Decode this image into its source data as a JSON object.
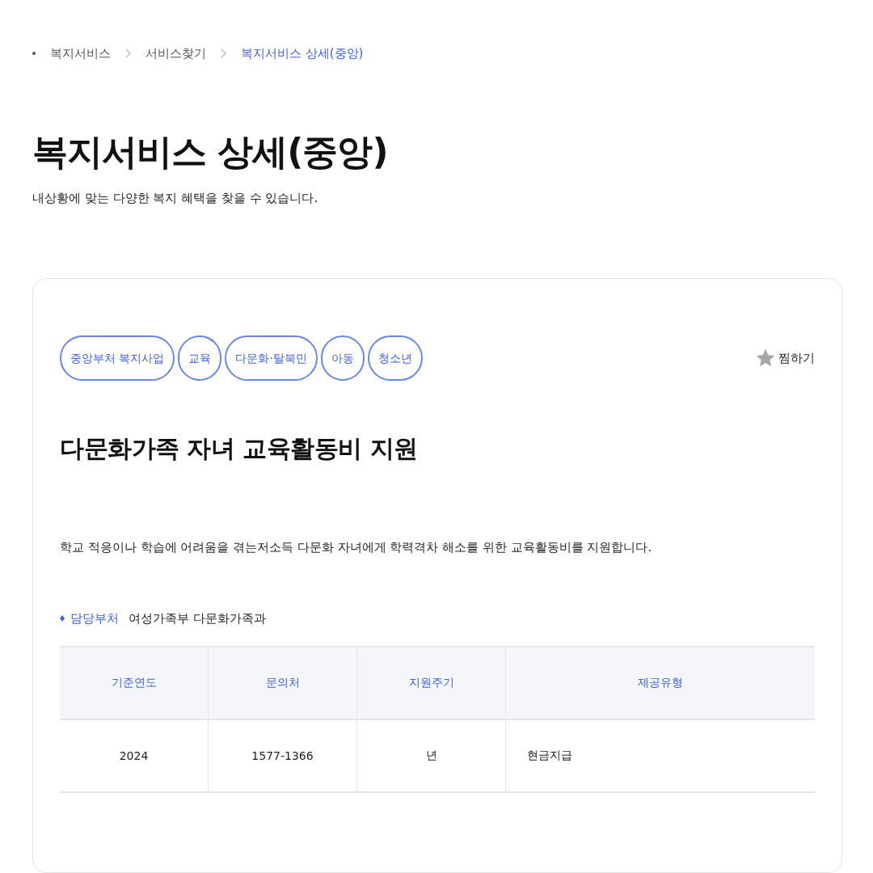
{
  "breadcrumb": [
    {
      "label": "복지서비스",
      "current": false
    },
    {
      "label": "서비스찾기",
      "current": false
    },
    {
      "label": "복지서비스 상세(중앙)",
      "current": true
    }
  ],
  "page": {
    "title": "복지서비스 상세(중앙)",
    "subtitle": "내상황에 맞는 다양한 복지 혜택을 찾을 수 있습니다."
  },
  "service": {
    "tags": [
      "중앙부처 복지사업",
      "교육",
      "다문화·탈북민",
      "아동",
      "청소년"
    ],
    "favorite": {
      "label": "찜하기",
      "on": false
    },
    "title": "다문화가족 자녀 교육활동비 지원",
    "description": "학교 적응이나 학습에 어려움을 겪는저소득 다문화 자녀에게 학력격차 해소를 위한 교육활동비를 지원합니다.",
    "department": {
      "label": "담당부처",
      "value": "여성가족부 다문화가족과"
    },
    "table": {
      "columns": [
        "기준연도",
        "문의처",
        "지원주기",
        "제공유형"
      ],
      "rows": [
        [
          "2024",
          "1577-1366",
          "년",
          "현금지급"
        ]
      ]
    }
  }
}
